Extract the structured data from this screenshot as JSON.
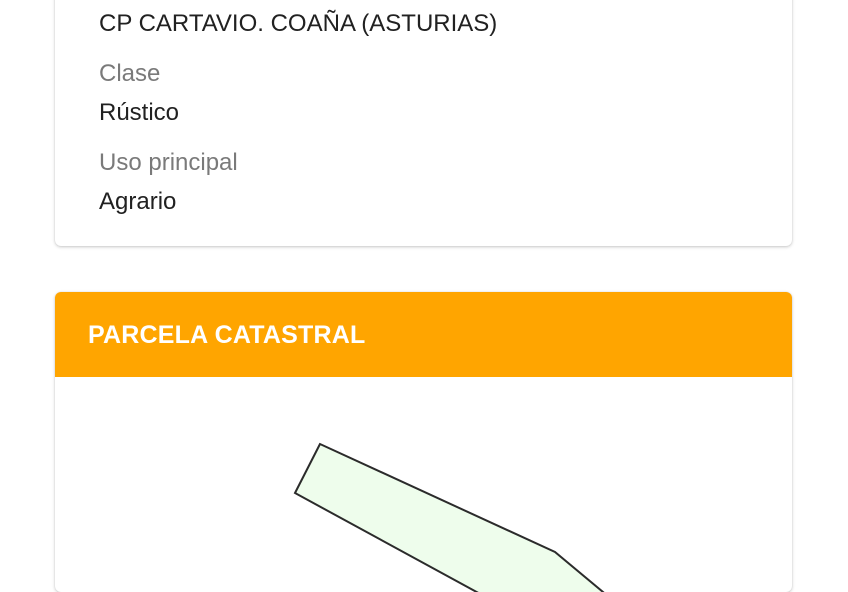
{
  "info_card": {
    "address_value": "CP CARTAVIO. COAÑA (ASTURIAS)",
    "clase_label": "Clase",
    "clase_value": "Rústico",
    "uso_label": "Uso principal",
    "uso_value": "Agrario"
  },
  "parcel_card": {
    "title": "PARCELA CATASTRAL",
    "header_color": "#FFA500",
    "parcel_fill": "#EEFDEC",
    "parcel_stroke": "#2b2b2b"
  }
}
